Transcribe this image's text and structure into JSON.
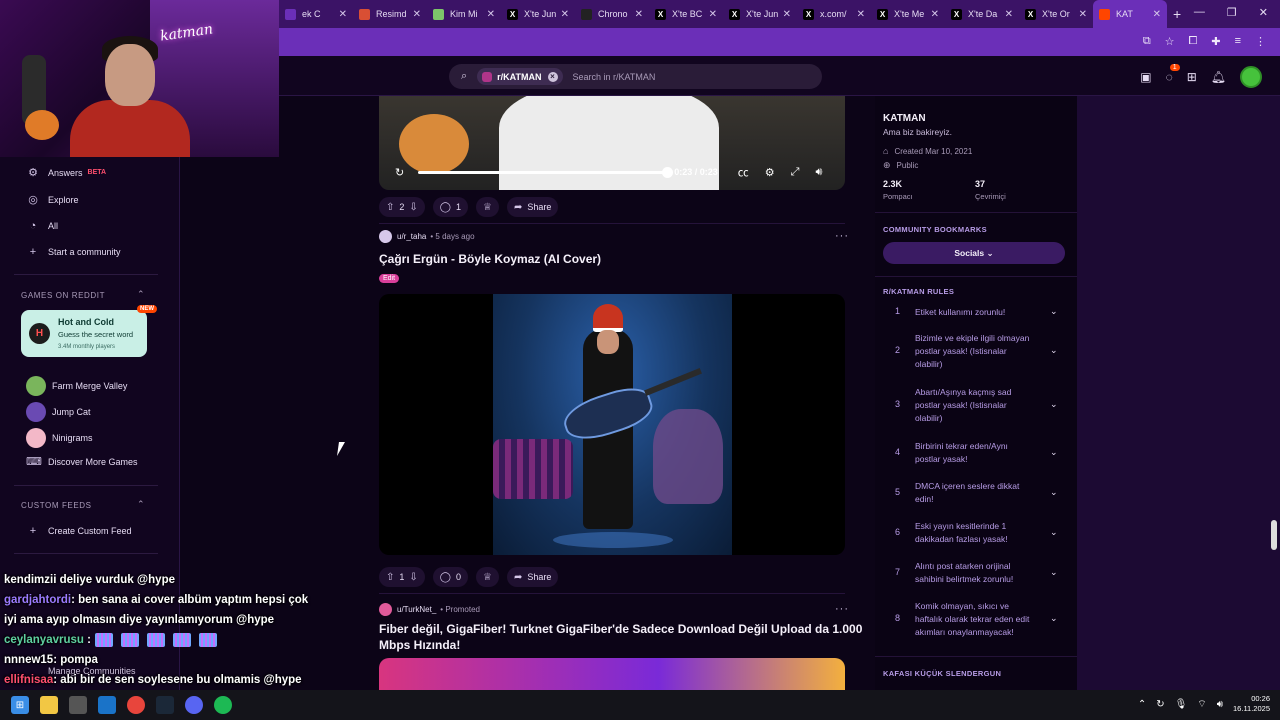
{
  "browser": {
    "tabs": [
      {
        "label": "ek C",
        "fav": "",
        "favcolor": "#6b2fb8"
      },
      {
        "label": "Resimd",
        "fav": "",
        "favcolor": "#d94f34"
      },
      {
        "label": "Kim Mi",
        "fav": "",
        "favcolor": "#7dc56a"
      },
      {
        "label": "X'te Jun",
        "fav": "X",
        "favcolor": "#000000"
      },
      {
        "label": "Chrono",
        "fav": "",
        "favcolor": "#222222"
      },
      {
        "label": "X'te BC",
        "fav": "X",
        "favcolor": "#000000"
      },
      {
        "label": "X'te Jun",
        "fav": "X",
        "favcolor": "#000000"
      },
      {
        "label": "x.com/",
        "fav": "X",
        "favcolor": "#000000"
      },
      {
        "label": "X'te Me",
        "fav": "X",
        "favcolor": "#000000"
      },
      {
        "label": "X'te Da",
        "fav": "X",
        "favcolor": "#000000"
      },
      {
        "label": "X'te Or",
        "fav": "X",
        "favcolor": "#000000"
      },
      {
        "label": "KAT",
        "fav": "",
        "favcolor": "#ff4500",
        "active": true
      }
    ],
    "new_tab": "+",
    "win_min": "—",
    "win_max": "❐",
    "win_close": "✕"
  },
  "header": {
    "search_chip": "r/KATMAN",
    "search_placeholder": "Search in r/KATMAN",
    "notif_count": "1"
  },
  "sidebar": {
    "items_top": [
      {
        "label": "Answers",
        "badge": "BETA",
        "icon": "answers-icon"
      },
      {
        "label": "Explore",
        "icon": "explore-icon"
      },
      {
        "label": "All",
        "icon": "all-icon"
      },
      {
        "label": "Start a community",
        "icon": "plus-icon"
      }
    ],
    "games_heading": "GAMES ON REDDIT",
    "featured_game": {
      "title": "Hot and Cold",
      "subtitle": "Guess the secret word",
      "meta": "3.4M monthly players",
      "badge": "NEW"
    },
    "games": [
      {
        "label": "Farm Merge Valley",
        "color": "#7ab55c"
      },
      {
        "label": "Jump Cat",
        "color": "#6a4ab3"
      },
      {
        "label": "Ninigrams",
        "color": "#f3b8c8"
      }
    ],
    "discover": "Discover More Games",
    "custom_feeds_heading": "CUSTOM FEEDS",
    "create_feed": "Create Custom Feed",
    "manage": "Manage Communities"
  },
  "video": {
    "time": "0:23 / 0:23",
    "progress": 1.0
  },
  "posts": [
    {
      "votes": "2",
      "comments": "1",
      "share": "Share"
    },
    {
      "author": "u/r_taha",
      "time": "5 days ago",
      "title": "Çağrı Ergün - Böyle Koymaz (AI Cover)",
      "flair": "Edit",
      "votes": "1",
      "comments": "0",
      "share": "Share"
    },
    {
      "author": "u/TurkNet_",
      "promoted": "Promoted",
      "title_l1": "Fiber değil, GigaFiber! Turknet GigaFiber'de Sadece Download Değil Upload da 1.000",
      "title_l2": "Mbps Hızında!"
    }
  ],
  "community": {
    "name": "KATMAN",
    "description": "Ama biz bakireyiz.",
    "created": "Created Mar 10, 2021",
    "visibility": "Public",
    "members": "2.3K",
    "members_label": "Pompacı",
    "online": "37",
    "online_label": "Çevrimiçi",
    "bookmarks_heading": "COMMUNITY BOOKMARKS",
    "socials": "Socials",
    "rules_heading": "R/KATMAN RULES",
    "rules": [
      {
        "n": "1",
        "lines": [
          "Etiket kullanımı zorunlu!"
        ]
      },
      {
        "n": "2",
        "lines": [
          "Bizimle ve ekiple ilgili olmayan",
          "postlar yasak! (Istisnalar",
          "olabilir)"
        ]
      },
      {
        "n": "3",
        "lines": [
          "Abartı/Aşınya kaçmış sad",
          "postlar yasak! (Istisnalar",
          "olabilir)"
        ]
      },
      {
        "n": "4",
        "lines": [
          "Birbirini tekrar eden/Aynı",
          "postlar yasak!"
        ]
      },
      {
        "n": "5",
        "lines": [
          "DMCA içeren seslere dikkat",
          "edin!"
        ]
      },
      {
        "n": "6",
        "lines": [
          "Eski yayın kesitlerinde 1",
          "dakikadan fazlası yasak!"
        ]
      },
      {
        "n": "7",
        "lines": [
          "Alıntı post atarken orijinal",
          "sahibini belirtmek zorunlu!"
        ]
      },
      {
        "n": "8",
        "lines": [
          "Komik olmayan, sıkıcı ve",
          "haftalık olarak tekrar eden edit",
          "akımları onaylanmayacak!"
        ]
      }
    ],
    "next_heading": "KAFASI KÜÇÜK SLENDERGUN"
  },
  "chat": [
    {
      "user": "",
      "text": "kendimzii deliye vurduk @hype"
    },
    {
      "user": "gardjahtordi",
      "text": ": ben sana ai cover albüm yaptım hepsi çok"
    },
    {
      "user": "",
      "text": "iyi ama ayıp olmasın diye yayınlamıyorum @hype"
    },
    {
      "user": "ceylanyavrusu",
      "text": ":"
    },
    {
      "user": "nnnew15",
      "text": ": pompa"
    },
    {
      "user": "ellifnisaa",
      "text": ": abi bir de sen soylesene bu olmamis @hype"
    }
  ],
  "webcam": {
    "sign": "katman"
  },
  "taskbar": {
    "time": "00:26",
    "date": "16.11.2025"
  }
}
